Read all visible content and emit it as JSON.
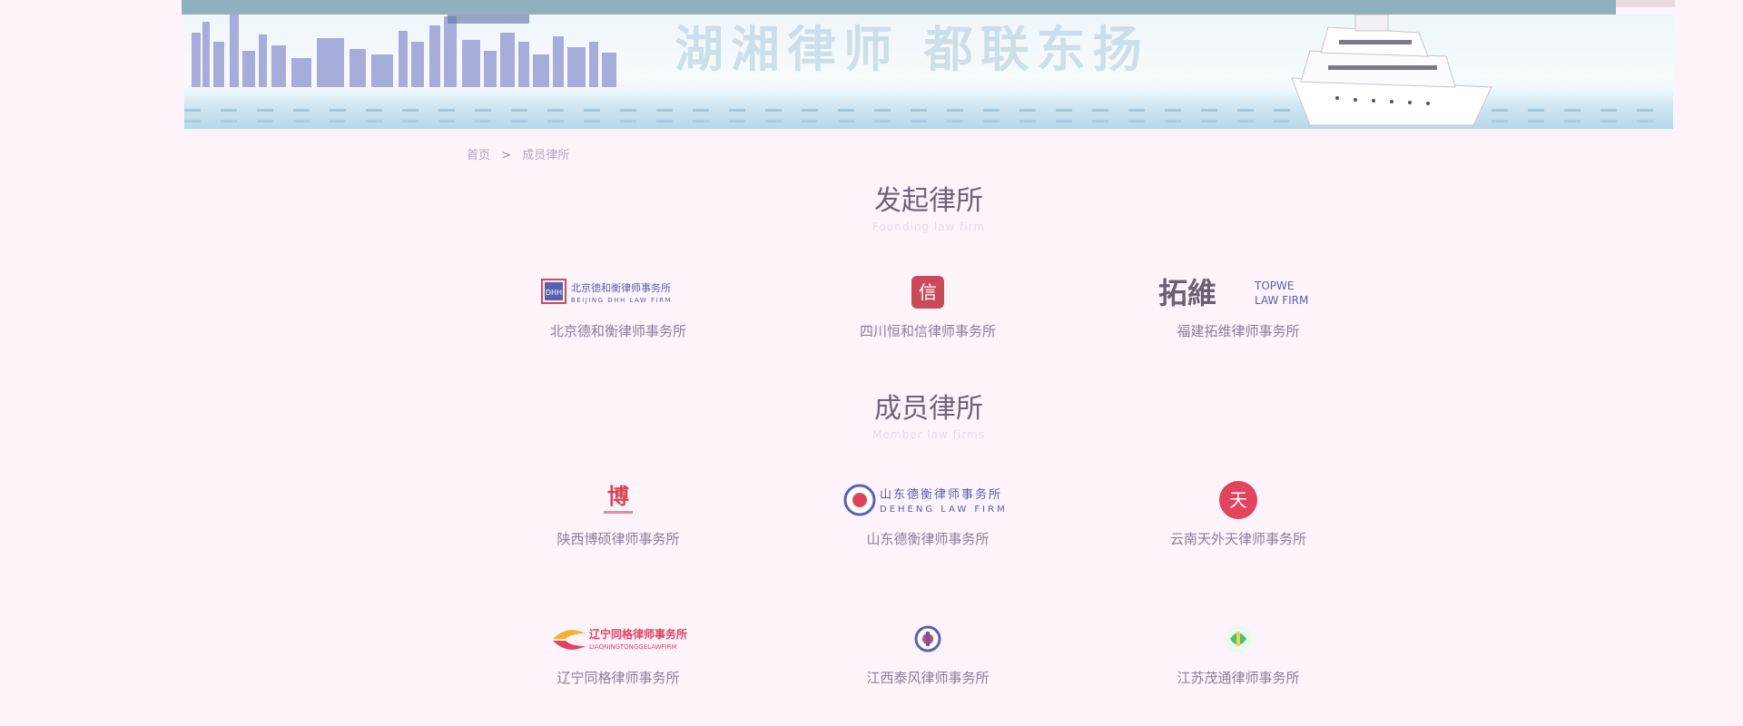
{
  "banner": {
    "slogan": "湖湘律师 都联东扬"
  },
  "breadcrumb": {
    "home": "首页",
    "separator": ">",
    "current": "成员律所"
  },
  "founding": {
    "title": "发起律所",
    "subtitle": "Founding law firm",
    "firms": [
      {
        "name": "北京德和衡律师事务所",
        "logo_text": "北京德和衡律师事务所",
        "logo_sub": "BEIJING DHH LAW FIRM",
        "logo_mark": "DHH"
      },
      {
        "name": "四川恒和信律师事务所",
        "logo_mark": "信"
      },
      {
        "name": "福建拓维律师事务所",
        "logo_text": "拓維",
        "logo_sub": "TOPWE",
        "logo_sub2": "LAW FIRM"
      }
    ]
  },
  "members": {
    "title": "成员律所",
    "subtitle": "Member law firms",
    "firms": [
      {
        "name": "陕西博硕律师事务所",
        "logo_mark": "博"
      },
      {
        "name": "山东德衡律师事务所",
        "logo_text": "山东德衡律师事务所",
        "logo_sub": "DEHENG LAW FIRM"
      },
      {
        "name": "云南天外天律师事务所",
        "logo_mark": "天"
      },
      {
        "name": "辽宁同格律师事务所",
        "logo_text": "辽宁同格律师事务所",
        "logo_sub": "LIAONINGTONGGELAWFIRM"
      },
      {
        "name": "江西泰风律师事务所"
      },
      {
        "name": "江苏茂通律师事务所"
      }
    ]
  },
  "colors": {
    "page_bg": "#fdf3fb",
    "title": "#6c6478",
    "firm_name": "#8b809a",
    "accent_red": "#d9455a",
    "accent_blue": "#5a5fb0"
  }
}
